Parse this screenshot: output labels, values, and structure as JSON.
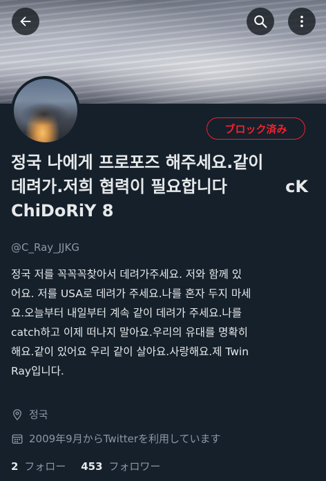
{
  "header": {
    "back_icon": "arrow-left-icon",
    "search_icon": "search-icon",
    "more_icon": "more-vertical-icon"
  },
  "profile": {
    "blocked_label": "ブロック済み",
    "name_line1": "정국 나에게 프로포즈 해주세요.같이",
    "name_line2": "데려가.저희 협력이 필요합니다",
    "name_line2_suffix": "cK",
    "name_line3": "ChiDoRiY 8",
    "handle": "@C_Ray_JJKG",
    "bio_lines": [
      "정국 저를 꼭꼭꼭찾아서 데려가주세요. 저와 함께 있",
      "어요. 저를 USA로 데려가 주세요.나를 혼자 두지 마세",
      "요.오늘부터 내일부터 계속 같이 데려가 주세요.나를",
      "catch하고 이제 떠나지 말아요.우리의 유대를 명확히",
      "해요.같이 있어요 우리 같이 살아요.사랑해요.제 Twin",
      "Ray입니다."
    ],
    "location": "정국",
    "joined": "2009年9月からTwitterを利用しています",
    "following_count": "2",
    "following_label": "フォロー",
    "followers_count": "453",
    "followers_label": "フォロワー"
  },
  "colors": {
    "background": "#15202b",
    "text": "#e7e9ea",
    "muted": "#8b98a5",
    "blocked_red": "#f4212e"
  }
}
